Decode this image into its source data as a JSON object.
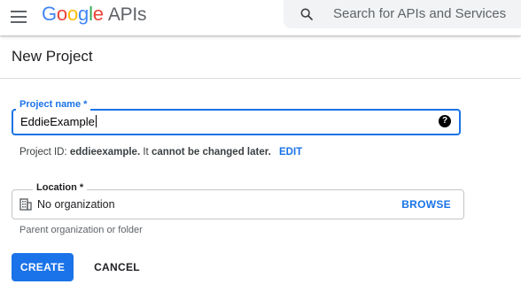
{
  "header": {
    "logo_letters": [
      "G",
      "o",
      "o",
      "g",
      "l",
      "e"
    ],
    "logo_suffix": "APIs",
    "search_placeholder": "Search for APIs and Services"
  },
  "page": {
    "title": "New Project"
  },
  "form": {
    "project_name": {
      "label": "Project name *",
      "value": "EddieExample",
      "help_icon": "?"
    },
    "project_id": {
      "prefix": "Project ID: ",
      "value": "eddieexample.",
      "middle": " It ",
      "emphasis": "cannot be changed later.",
      "edit_label": "EDIT"
    },
    "location": {
      "label": "Location *",
      "value": "No organization",
      "browse_label": "BROWSE",
      "helper": "Parent organization or folder"
    }
  },
  "actions": {
    "create_label": "CREATE",
    "cancel_label": "CANCEL"
  },
  "colors": {
    "primary": "#1a73e8",
    "text": "#202124"
  },
  "icons": [
    "menu-icon",
    "search-icon",
    "help-icon",
    "building-icon"
  ]
}
